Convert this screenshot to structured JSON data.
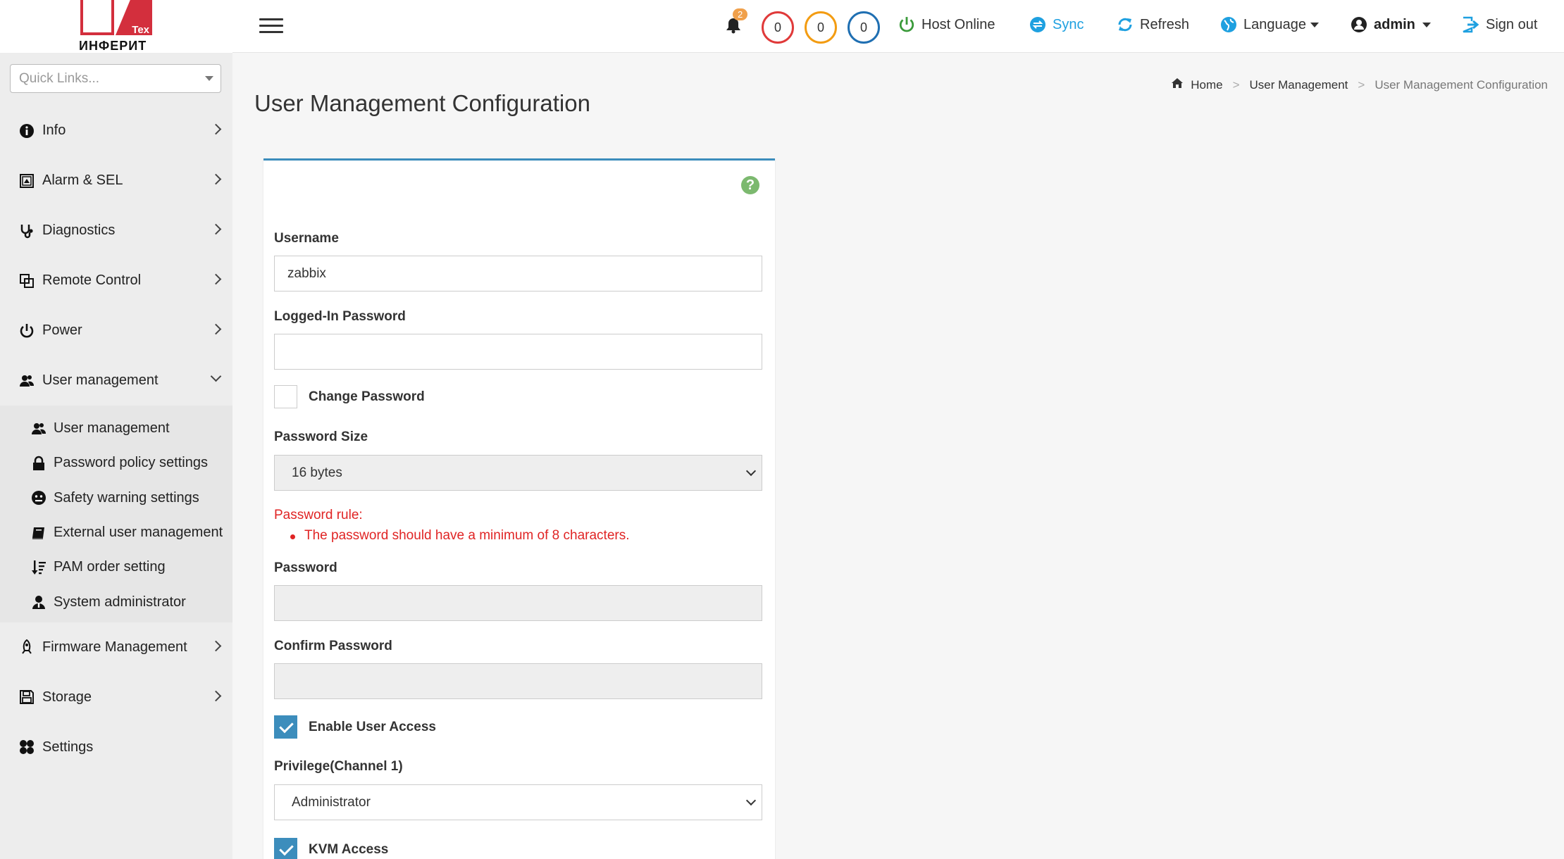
{
  "brand": {
    "logo_tex": "Tex",
    "logo_text": "ИНФЕРИТ"
  },
  "sidebar": {
    "quick_links_placeholder": "Quick Links...",
    "items": [
      {
        "label": "Info",
        "icon": "info-icon"
      },
      {
        "label": "Alarm & SEL",
        "icon": "alarm-icon"
      },
      {
        "label": "Diagnostics",
        "icon": "stethoscope-icon"
      },
      {
        "label": "Remote Control",
        "icon": "remote-control-icon"
      },
      {
        "label": "Power",
        "icon": "power-icon"
      },
      {
        "label": "User management",
        "icon": "users-icon",
        "expanded": true
      }
    ],
    "subitems": [
      {
        "label": "User management",
        "icon": "users-icon"
      },
      {
        "label": "Password policy settings",
        "icon": "lock-icon"
      },
      {
        "label": "Safety warning settings",
        "icon": "warning-face-icon"
      },
      {
        "label": "External user management",
        "icon": "book-icon"
      },
      {
        "label": "PAM order setting",
        "icon": "sort-icon"
      },
      {
        "label": "System administrator",
        "icon": "admin-icon"
      }
    ],
    "items_after": [
      {
        "label": "Firmware Management",
        "icon": "rocket-icon"
      },
      {
        "label": "Storage",
        "icon": "save-icon"
      },
      {
        "label": "Settings",
        "icon": "settings-icon"
      }
    ]
  },
  "header": {
    "notification_count": "2",
    "status_counts": [
      {
        "value": "0",
        "color": "#e03a3a"
      },
      {
        "value": "0",
        "color": "#f39c12"
      },
      {
        "value": "0",
        "color": "#1f6fb2"
      }
    ],
    "host_status": "Host Online",
    "sync": "Sync",
    "refresh": "Refresh",
    "language": "Language",
    "user": "admin",
    "sign_out": "Sign out"
  },
  "breadcrumb": {
    "home": "Home",
    "parent": "User Management",
    "current": "User Management Configuration"
  },
  "page_title": "User Management Configuration",
  "form": {
    "username_label": "Username",
    "username_value": "zabbix",
    "logged_in_password_label": "Logged-In Password",
    "logged_in_password_value": "",
    "change_password_label": "Change Password",
    "change_password_checked": false,
    "password_size_label": "Password Size",
    "password_size_value": "16 bytes",
    "password_rule_title": "Password rule:",
    "password_rule_item": "The password should have a minimum of 8 characters.",
    "password_label": "Password",
    "confirm_password_label": "Confirm Password",
    "enable_user_access_label": "Enable User Access",
    "enable_user_access_checked": true,
    "privilege_label": "Privilege(Channel 1)",
    "privilege_value": "Administrator",
    "kvm_access_label": "KVM Access",
    "kvm_access_checked": true
  },
  "colors": {
    "accent": "#3c8dbc",
    "error": "#e02424",
    "host_online": "#3a9a3a",
    "sync": "#1ea0e0",
    "help": "#7cb96f"
  }
}
